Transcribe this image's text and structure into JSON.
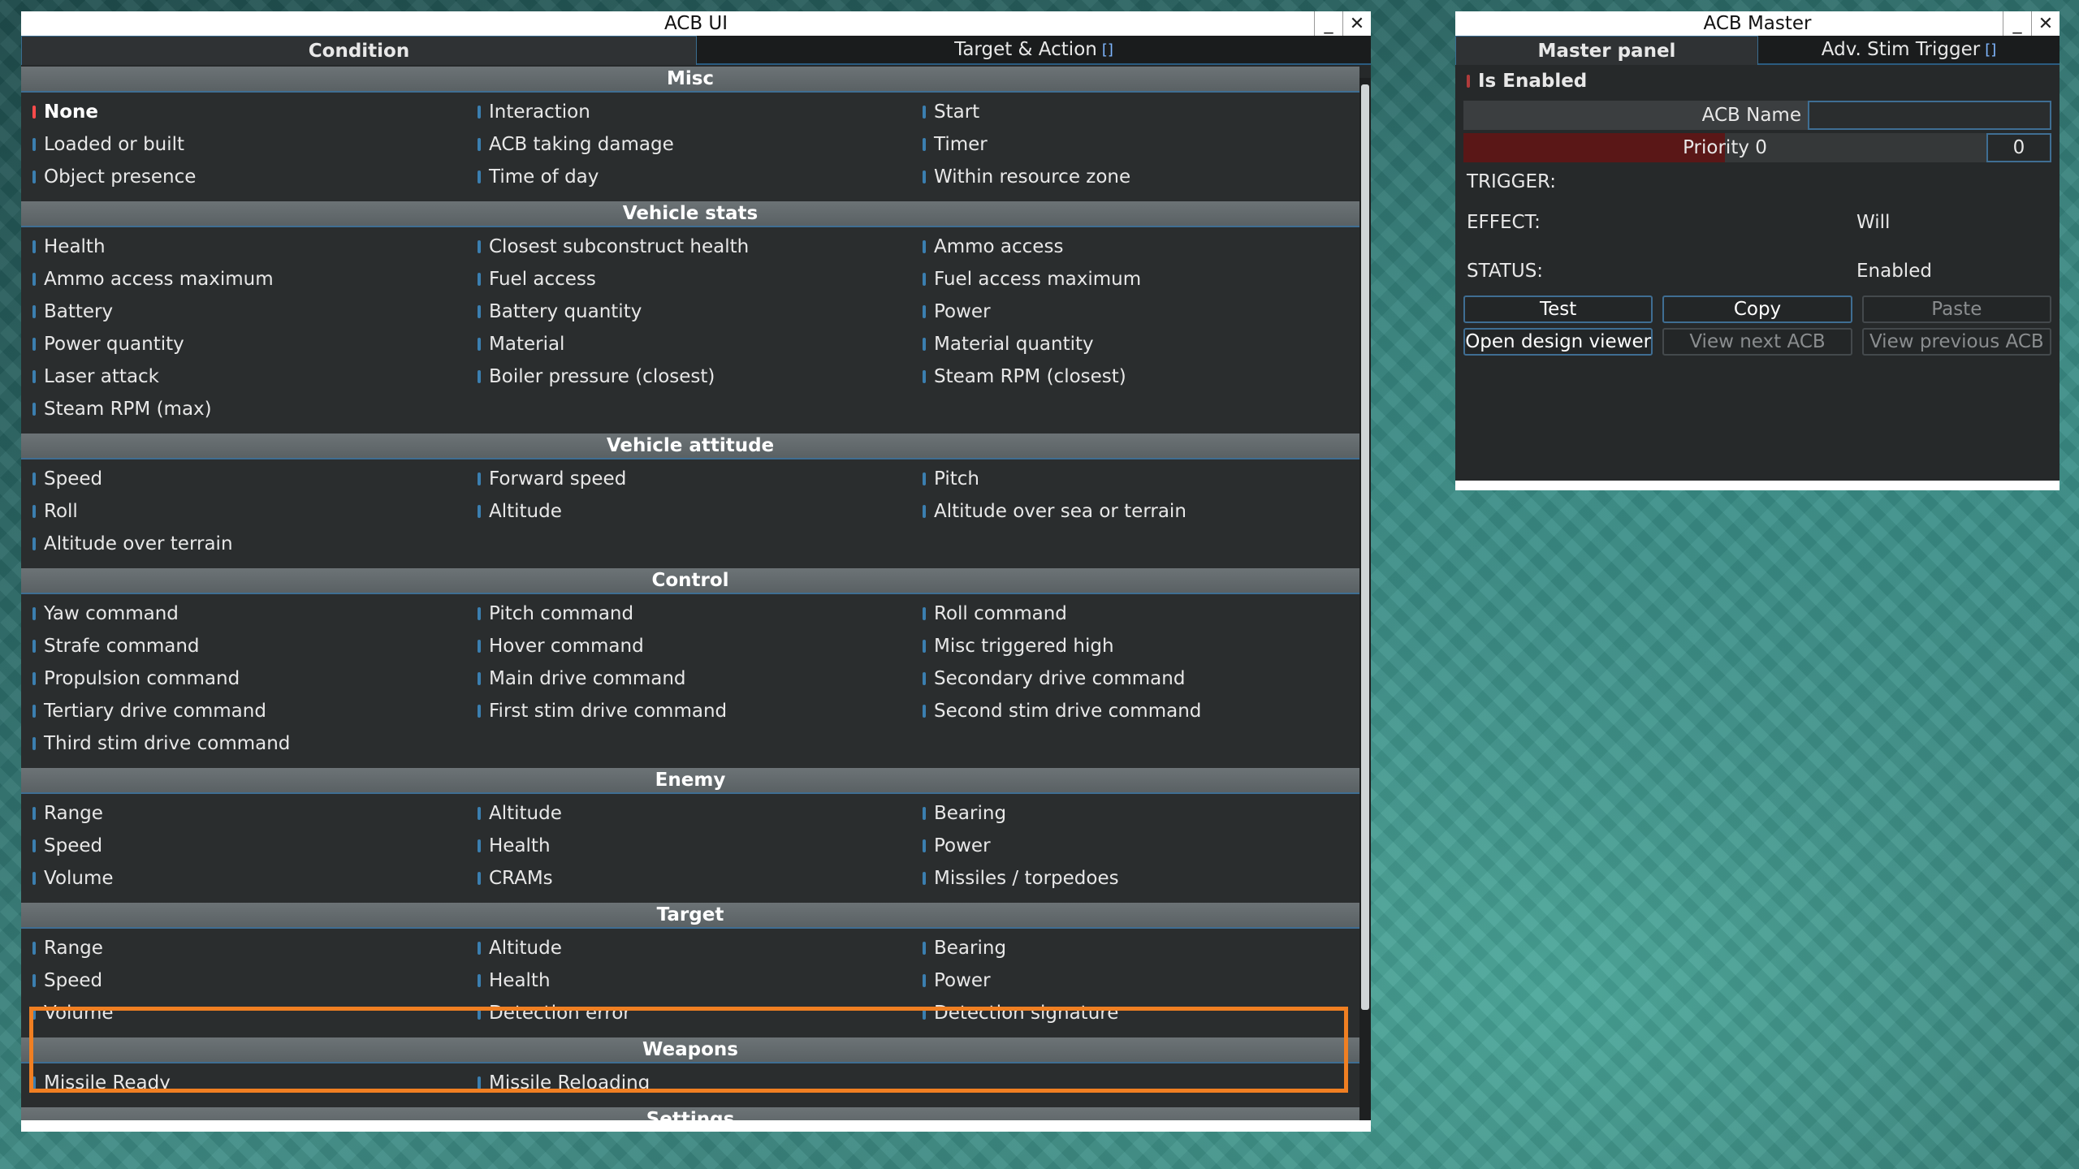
{
  "acb_ui": {
    "title": "ACB UI",
    "minimize": "_",
    "close": "✕",
    "tabs": [
      {
        "label": "Condition"
      },
      {
        "label": "Target & Action",
        "bracket": "[]"
      }
    ],
    "sections": [
      {
        "header": "Misc",
        "items": [
          "None",
          "Interaction",
          "Start",
          "Loaded or built",
          "ACB taking damage",
          "Timer",
          "Object presence",
          "Time of day",
          "Within resource zone"
        ]
      },
      {
        "header": "Vehicle stats",
        "items": [
          "Health",
          "Closest subconstruct health",
          "Ammo access",
          "Ammo access maximum",
          "Fuel access",
          "Fuel access maximum",
          "Battery",
          "Battery quantity",
          "Power",
          "Power quantity",
          "Material",
          "Material quantity",
          "Laser attack",
          "Boiler pressure (closest)",
          "Steam RPM (closest)",
          "Steam RPM (max)"
        ]
      },
      {
        "header": "Vehicle attitude",
        "items": [
          "Speed",
          "Forward speed",
          "Pitch",
          "Roll",
          "Altitude",
          "Altitude over sea or terrain",
          "Altitude over terrain"
        ]
      },
      {
        "header": "Control",
        "items": [
          "Yaw command",
          "Pitch command",
          "Roll command",
          "Strafe command",
          "Hover command",
          "Misc triggered high",
          "Propulsion command",
          "Main drive command",
          "Secondary drive command",
          "Tertiary drive command",
          "First stim drive command",
          "Second stim drive command",
          "Third stim drive command"
        ]
      },
      {
        "header": "Enemy",
        "items": [
          "Range",
          "Altitude",
          "Bearing",
          "Speed",
          "Health",
          "Power",
          "Volume",
          "CRAMs",
          "Missiles / torpedoes"
        ]
      },
      {
        "header": "Target",
        "items": [
          "Range",
          "Altitude",
          "Bearing",
          "Speed",
          "Health",
          "Power",
          "Volume",
          "Detection error",
          "Detection signature"
        ]
      },
      {
        "header": "Weapons",
        "items": [
          "Missile Ready",
          "Missile Reloading"
        ]
      },
      {
        "header": "Settings",
        "items": []
      }
    ],
    "selected_item": "None"
  },
  "acb_master": {
    "title": "ACB Master",
    "minimize": "_",
    "close": "✕",
    "tabs": [
      {
        "label": "Master panel"
      },
      {
        "label": "Adv. Stim Trigger",
        "bracket": "[]"
      }
    ],
    "is_enabled_label": "Is Enabled",
    "acb_name_label": "ACB Name",
    "acb_name_value": "",
    "priority_label": "Priority 0",
    "priority_value": "0",
    "trigger_label": "TRIGGER:",
    "trigger_value": "",
    "effect_label": "EFFECT:",
    "effect_value": "Will",
    "status_label": "STATUS:",
    "status_value": "Enabled",
    "buttons_row1": [
      {
        "label": "Test",
        "enabled": true
      },
      {
        "label": "Copy",
        "enabled": true
      },
      {
        "label": "Paste",
        "enabled": false
      }
    ],
    "buttons_row2": [
      {
        "label": "Open design viewer",
        "enabled": true
      },
      {
        "label": "View next ACB",
        "enabled": false
      },
      {
        "label": "View previous ACB",
        "enabled": false
      }
    ]
  },
  "colors": {
    "accent_blue": "#3f6e93",
    "highlight_orange": "#f07f22",
    "selected_dot": "#ff4b4b"
  }
}
